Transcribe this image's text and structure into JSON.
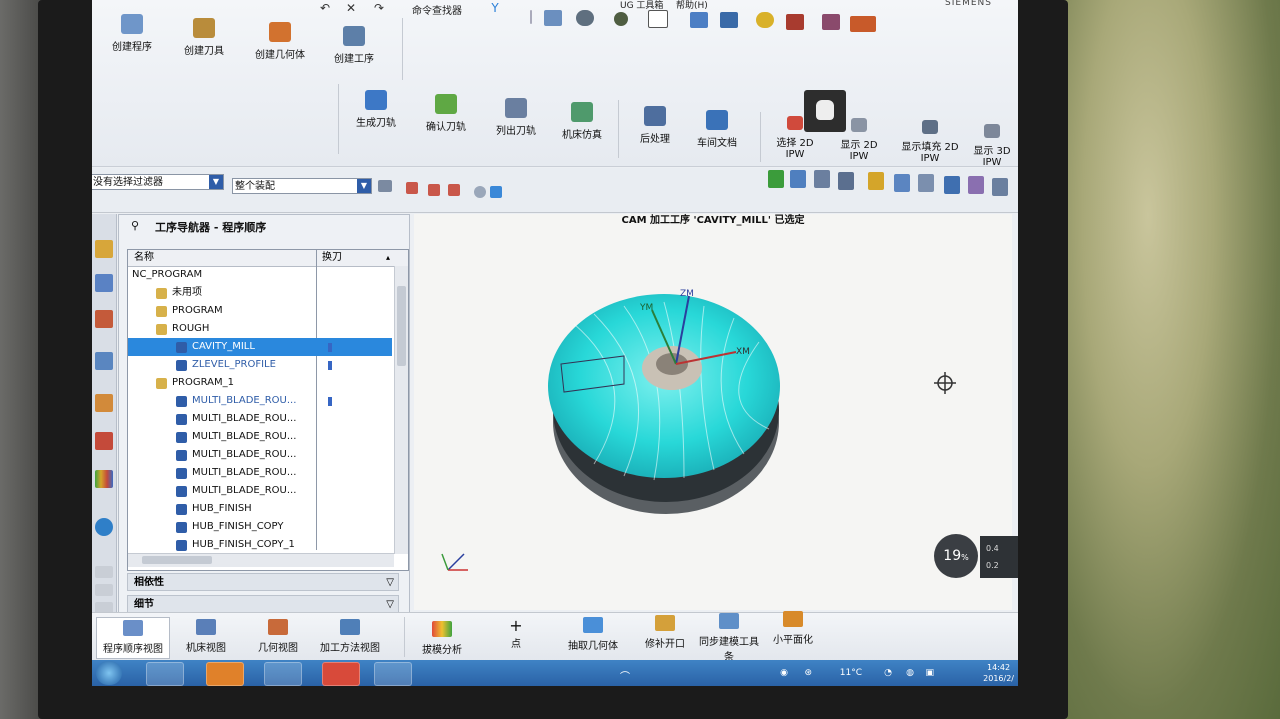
{
  "monitor": {
    "brand": "SIEMENS"
  },
  "toolbar": {
    "command_finder": "命令查找器",
    "menu_partial": "UG 工具箱",
    "help_menu": "帮助(H)"
  },
  "ribbon": {
    "insert_group": [
      {
        "label": "创建程序",
        "icon": "create-program-icon"
      },
      {
        "label": "创建刀具",
        "icon": "create-tool-icon"
      },
      {
        "label": "创建几何体",
        "icon": "create-geometry-icon"
      },
      {
        "label": "创建工序",
        "icon": "create-operation-icon"
      }
    ],
    "operations_group": [
      {
        "label": "生成刀轨",
        "icon": "generate-toolpath-icon"
      },
      {
        "label": "确认刀轨",
        "icon": "verify-toolpath-icon"
      },
      {
        "label": "列出刀轨",
        "icon": "list-toolpath-icon"
      },
      {
        "label": "机床仿真",
        "icon": "machine-simulation-icon"
      },
      {
        "label": "后处理",
        "icon": "postprocess-icon"
      },
      {
        "label": "车间文档",
        "icon": "shop-docs-icon"
      }
    ],
    "ipw_group": [
      {
        "label": "选择 2D IPW",
        "icon": "select-2d-ipw-icon"
      },
      {
        "label": "显示 2D IPW",
        "icon": "show-2d-ipw-icon"
      },
      {
        "label": "显示填充 2D IPW",
        "icon": "show-filled-2d-ipw-icon"
      },
      {
        "label": "显示 3D IPW",
        "icon": "show-3d-ipw-icon"
      }
    ]
  },
  "filters": {
    "selection_filter": "没有选择过滤器",
    "assembly_scope": "整个装配"
  },
  "graphics": {
    "status_title": "CAM 加工工序 'CAVITY_MILL' 已选定",
    "axes": {
      "z": "ZM",
      "y": "YM",
      "x": "XM"
    },
    "progress_percent": "19",
    "progress_suffix": "%",
    "side_values": [
      "0.4",
      "0.2"
    ]
  },
  "navigator": {
    "title": "工序导航器 - 程序顺序",
    "columns": [
      "名称",
      "换刀"
    ],
    "rows": [
      {
        "name": "NC_PROGRAM",
        "indent": 0,
        "type": "root",
        "tool_change": false,
        "selected": false,
        "color": "#111111"
      },
      {
        "name": "未用项",
        "indent": 1,
        "type": "folder",
        "tool_change": false,
        "selected": false,
        "color": "#111111"
      },
      {
        "name": "PROGRAM",
        "indent": 1,
        "type": "program",
        "tool_change": false,
        "selected": false,
        "color": "#111111"
      },
      {
        "name": "ROUGH",
        "indent": 1,
        "type": "program",
        "tool_change": false,
        "selected": false,
        "color": "#111111"
      },
      {
        "name": "CAVITY_MILL",
        "indent": 2,
        "type": "operation",
        "tool_change": true,
        "selected": true,
        "color": "#ffffff"
      },
      {
        "name": "ZLEVEL_PROFILE",
        "indent": 2,
        "type": "operation",
        "tool_change": true,
        "selected": false,
        "color": "#2f5da8"
      },
      {
        "name": "PROGRAM_1",
        "indent": 1,
        "type": "program",
        "tool_change": false,
        "selected": false,
        "color": "#111111"
      },
      {
        "name": "MULTI_BLADE_ROU...",
        "indent": 2,
        "type": "operation",
        "tool_change": true,
        "selected": false,
        "color": "#2f5da8"
      },
      {
        "name": "MULTI_BLADE_ROU...",
        "indent": 2,
        "type": "operation",
        "tool_change": false,
        "selected": false,
        "color": "#111111"
      },
      {
        "name": "MULTI_BLADE_ROU...",
        "indent": 2,
        "type": "operation",
        "tool_change": false,
        "selected": false,
        "color": "#111111"
      },
      {
        "name": "MULTI_BLADE_ROU...",
        "indent": 2,
        "type": "operation",
        "tool_change": false,
        "selected": false,
        "color": "#111111"
      },
      {
        "name": "MULTI_BLADE_ROU...",
        "indent": 2,
        "type": "operation",
        "tool_change": false,
        "selected": false,
        "color": "#111111"
      },
      {
        "name": "MULTI_BLADE_ROU...",
        "indent": 2,
        "type": "operation",
        "tool_change": false,
        "selected": false,
        "color": "#111111"
      },
      {
        "name": "HUB_FINISH",
        "indent": 2,
        "type": "operation",
        "tool_change": false,
        "selected": false,
        "color": "#111111"
      },
      {
        "name": "HUB_FINISH_COPY",
        "indent": 2,
        "type": "operation",
        "tool_change": false,
        "selected": false,
        "color": "#111111"
      },
      {
        "name": "HUB_FINISH_COPY_1",
        "indent": 2,
        "type": "operation",
        "tool_change": false,
        "selected": false,
        "color": "#111111"
      }
    ],
    "sections": [
      "相依性",
      "细节"
    ]
  },
  "bottom_toolbar": {
    "tabs": [
      "程序顺序视图",
      "机床视图",
      "几何视图",
      "加工方法视图"
    ],
    "tools": [
      {
        "label": "拔模分析",
        "icon": "draft-analysis-icon"
      },
      {
        "label": "点",
        "icon": "point-icon"
      },
      {
        "label": "抽取几何体",
        "icon": "extract-geometry-icon"
      },
      {
        "label": "修补开口",
        "icon": "patch-openings-icon"
      },
      {
        "label": "同步建模工具条",
        "icon": "sync-modeling-icon"
      },
      {
        "label": "小平面化",
        "icon": "facet-icon"
      }
    ]
  },
  "taskbar": {
    "temperature": "11°C",
    "time": "14:42",
    "date": "2016/2/"
  },
  "colors": {
    "selection": "#2a88dd",
    "accent_blue": "#2f5da8",
    "impeller_cyan": "#28d8d8",
    "taskbar": "#2a62a6"
  }
}
